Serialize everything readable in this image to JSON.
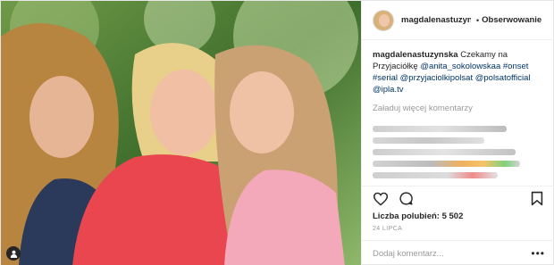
{
  "header": {
    "username": "magdalenastuzyns",
    "separator": "•",
    "follow_label": "Obserwowanie"
  },
  "caption": {
    "username": "magdalenastuzynska",
    "text_1": " Czekamy na Przyjaciółkę ",
    "mention_1": "@anita_sokolowskaa",
    "space_1": " ",
    "tag_1": "#onset",
    "space_2": " ",
    "tag_2": "#serial",
    "space_3": " ",
    "mention_2": "@przyjaciolkipolsat",
    "space_4": " ",
    "mention_3": "@polsatofficial",
    "space_5": " ",
    "mention_4": "@ipla.tv"
  },
  "load_more_label": "Załaduj więcej komentarzy",
  "icons": {
    "like": "heart-icon",
    "comment": "comment-icon",
    "save": "bookmark-icon",
    "user_tag": "user-tag-icon",
    "more": "more-options-icon"
  },
  "likes_text": "Liczba polubień: 5 502",
  "date_text": "24 LIPCA",
  "comment_placeholder": "Dodaj komentarz...",
  "more_glyph": "•••",
  "colors": {
    "link": "#003569",
    "muted": "#999999",
    "text": "#262626",
    "border": "#efefef"
  }
}
